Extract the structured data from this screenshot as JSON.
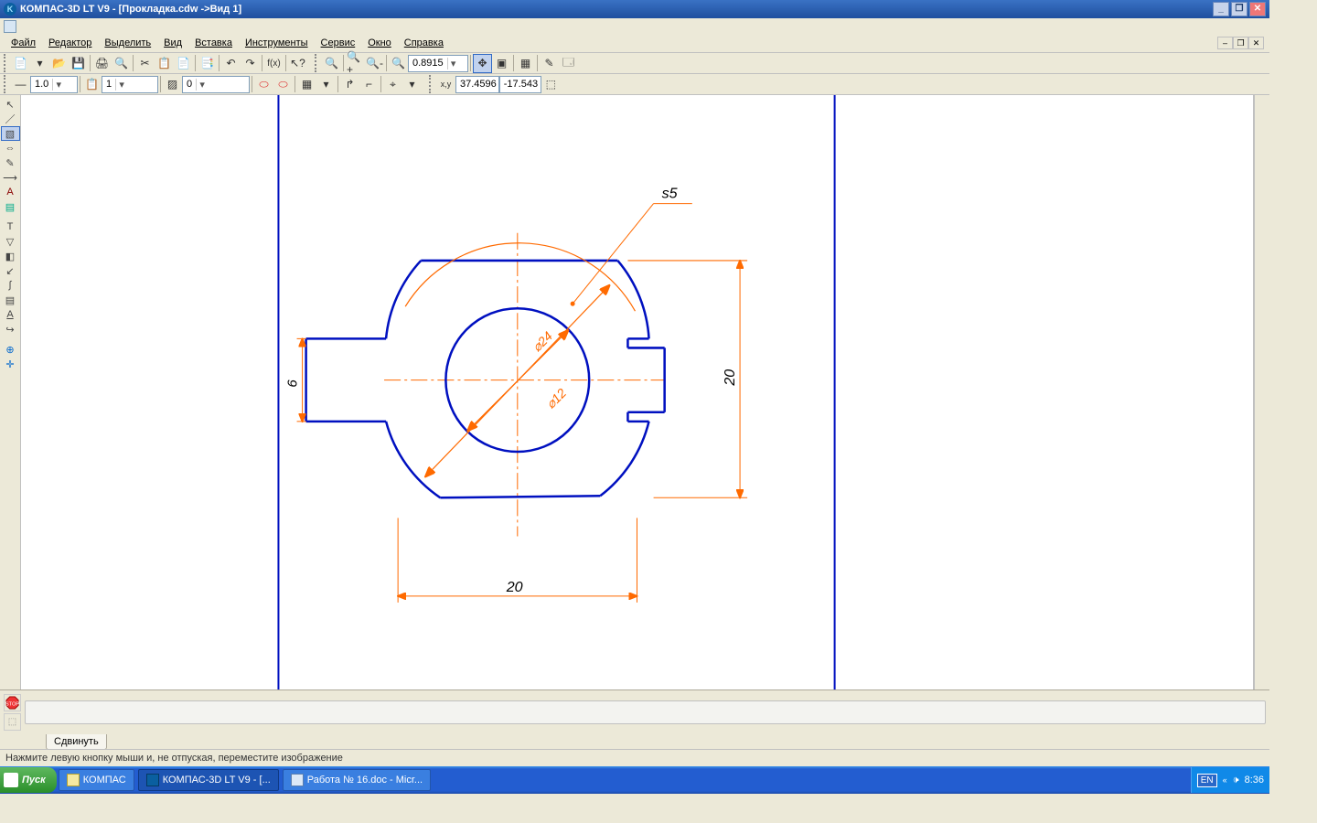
{
  "window": {
    "title": "КОМПАС-3D LT V9 - [Прокладка.cdw ->Вид 1]"
  },
  "menu": {
    "file": "Файл",
    "edit": "Редактор",
    "select": "Выделить",
    "view": "Вид",
    "insert": "Вставка",
    "tools": "Инструменты",
    "service": "Сервис",
    "window": "Окно",
    "help": "Справка"
  },
  "toolbar2": {
    "zoom_value": "0.8915"
  },
  "toolbar3": {
    "style_value": "1.0",
    "layer_value": "1",
    "line_value": "0",
    "coord_x": "37.4596",
    "coord_y": "-17.543"
  },
  "bottom": {
    "tab_label": "Сдвинуть",
    "status_text": "Нажмите левую кнопку мыши и, не отпуская, переместите изображение"
  },
  "taskbar": {
    "start": "Пуск",
    "items": [
      {
        "label": "КОМПАС"
      },
      {
        "label": "КОМПАС-3D LT V9 - [..."
      },
      {
        "label": "Работа № 16.doc - Micr..."
      }
    ],
    "lang": "EN",
    "time": "8:36"
  },
  "drawing": {
    "s_label": "s5",
    "dim_bottom": "20",
    "dim_right": "20",
    "dim_left": "6",
    "diam_outer": "⌀24",
    "diam_inner": "⌀12"
  }
}
